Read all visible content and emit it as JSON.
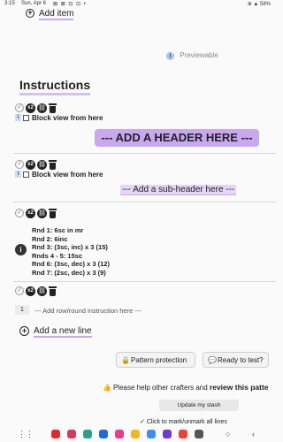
{
  "status_bar": {
    "time": "3:15",
    "date": "Sun, Apr 6",
    "icons": "⊠ ⊠ ⊡ ⊡ •",
    "battery": "⊕ ▲ 58%"
  },
  "add_item": {
    "label": "Add item"
  },
  "previewable": {
    "label": "Previewable"
  },
  "instructions": {
    "title": "Instructions"
  },
  "toolbar": {
    "check": "✓",
    "x2": "x2",
    "link": "⛓"
  },
  "blocks": [
    {
      "label": "Block view from here"
    },
    {
      "label": "Block view from here"
    }
  ],
  "header_placeholder": "--- ADD A HEADER HERE ---",
  "subheader_placeholder": "--- Add a sub-header here ---",
  "rounds_icon": "i",
  "rounds": [
    "Rnd 1: 6sc in mr",
    "Rnd 2: 6inc",
    "Rnd 3: (3sc, inc) x 3 (15)",
    "Rnds 4 - 5: 15sc",
    "Rnd 6: (3sc, dec) x 3 (12)",
    "Rnd 7: (2sc, dec) x 3 (9)"
  ],
  "row": {
    "number": "1",
    "placeholder": "--- Add row/round instruction here ---"
  },
  "add_line": {
    "label": "Add a new line"
  },
  "buttons": {
    "pattern_protection": "Pattern protection",
    "ready_to_test": "Ready to test?"
  },
  "help": {
    "text": "Please help other crafters and ",
    "link": "review this patte"
  },
  "update_stash": "Update my stash",
  "mark_all": "Click to mark/unmark all lines",
  "colors": {
    "accent": "#c9a8ef",
    "accent_light": "#e4d5f7"
  }
}
